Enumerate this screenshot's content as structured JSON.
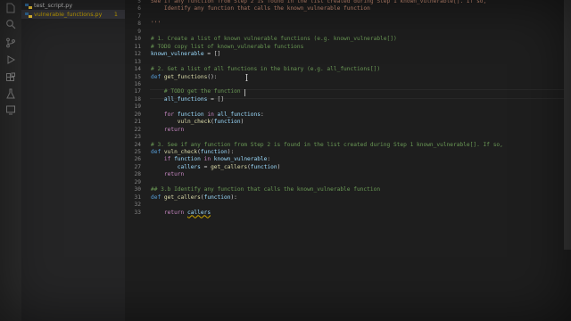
{
  "explorer": {
    "files": [
      {
        "name": "test_script.py",
        "badge": "",
        "active": false
      },
      {
        "name": "vulnerable_functions.py",
        "badge": "1",
        "active": true
      }
    ]
  },
  "activity_icons": [
    "files-icon",
    "search-icon",
    "source-control-icon",
    "run-debug-icon",
    "extensions-icon",
    "testing-icon",
    "remote-explorer-icon"
  ],
  "editor": {
    "lines": [
      {
        "n": "5",
        "segs": [
          {
            "c": "st",
            "t": "See if any function from Step 2 is found in the list created during Step 1 known_vulnerable[]. If so,"
          }
        ]
      },
      {
        "n": "6",
        "segs": [
          {
            "c": "st",
            "t": "    Identify any function that calls the known_vulnerable function"
          }
        ]
      },
      {
        "n": "7",
        "segs": []
      },
      {
        "n": "8",
        "segs": [
          {
            "c": "st",
            "t": "'''"
          }
        ]
      },
      {
        "n": "9",
        "segs": []
      },
      {
        "n": "10",
        "segs": [
          {
            "c": "cm",
            "t": "# 1. Create a list of known vulnerable functions (e.g. known_vulnerable[])"
          }
        ]
      },
      {
        "n": "11",
        "segs": [
          {
            "c": "cm",
            "t": "# TODO copy list of known_vulnerable functions"
          }
        ]
      },
      {
        "n": "12",
        "segs": [
          {
            "c": "vr",
            "t": "known_vulnerable"
          },
          {
            "c": "pl",
            "t": " = []"
          }
        ]
      },
      {
        "n": "13",
        "segs": []
      },
      {
        "n": "14",
        "segs": [
          {
            "c": "cm",
            "t": "# 2. Get a list of all functions in the binary (e.g. all_functions[])"
          }
        ]
      },
      {
        "n": "15",
        "segs": [
          {
            "c": "kd",
            "t": "def "
          },
          {
            "c": "fn",
            "t": "get_functions"
          },
          {
            "c": "pl",
            "t": "():"
          }
        ]
      },
      {
        "n": "16",
        "segs": []
      },
      {
        "n": "17",
        "segs": [
          {
            "c": "cm",
            "t": "    # TODO get the function "
          }
        ]
      },
      {
        "n": "18",
        "segs": [
          {
            "c": "vr",
            "t": "    all_functions"
          },
          {
            "c": "pl",
            "t": " = []"
          }
        ]
      },
      {
        "n": "19",
        "segs": []
      },
      {
        "n": "20",
        "segs": [
          {
            "c": "kw",
            "t": "    for "
          },
          {
            "c": "vr",
            "t": "function"
          },
          {
            "c": "kw",
            "t": " in "
          },
          {
            "c": "vr",
            "t": "all_functions"
          },
          {
            "c": "pl",
            "t": ":"
          }
        ]
      },
      {
        "n": "21",
        "segs": [
          {
            "c": "fn",
            "t": "        vuln_check"
          },
          {
            "c": "pl",
            "t": "("
          },
          {
            "c": "vr",
            "t": "function"
          },
          {
            "c": "pl",
            "t": ")"
          }
        ]
      },
      {
        "n": "22",
        "segs": [
          {
            "c": "kw",
            "t": "    return"
          }
        ]
      },
      {
        "n": "23",
        "segs": []
      },
      {
        "n": "24",
        "segs": [
          {
            "c": "cm",
            "t": "# 3. See if any function from Step 2 is found in the list created during Step 1 known_vulnerable[]. If so,"
          }
        ]
      },
      {
        "n": "25",
        "segs": [
          {
            "c": "kd",
            "t": "def "
          },
          {
            "c": "fn",
            "t": "vuln_check"
          },
          {
            "c": "pl",
            "t": "("
          },
          {
            "c": "vr",
            "t": "function"
          },
          {
            "c": "pl",
            "t": "):"
          }
        ]
      },
      {
        "n": "26",
        "segs": [
          {
            "c": "kw",
            "t": "    if "
          },
          {
            "c": "vr",
            "t": "function"
          },
          {
            "c": "kw",
            "t": " in "
          },
          {
            "c": "vr",
            "t": "known_vulnerable"
          },
          {
            "c": "pl",
            "t": ":"
          }
        ]
      },
      {
        "n": "27",
        "segs": [
          {
            "c": "vr",
            "t": "        callers"
          },
          {
            "c": "pl",
            "t": " = "
          },
          {
            "c": "fn",
            "t": "get_callers"
          },
          {
            "c": "pl",
            "t": "("
          },
          {
            "c": "vr",
            "t": "function"
          },
          {
            "c": "pl",
            "t": ")"
          }
        ]
      },
      {
        "n": "28",
        "segs": [
          {
            "c": "kw",
            "t": "    return"
          }
        ]
      },
      {
        "n": "29",
        "segs": []
      },
      {
        "n": "30",
        "segs": [
          {
            "c": "cm",
            "t": "## 3.b Identify any function that calls the known_vulnerable function"
          }
        ]
      },
      {
        "n": "31",
        "segs": [
          {
            "c": "kd",
            "t": "def "
          },
          {
            "c": "fn",
            "t": "get_callers"
          },
          {
            "c": "pl",
            "t": "("
          },
          {
            "c": "vr",
            "t": "function"
          },
          {
            "c": "pl",
            "t": "):"
          }
        ]
      },
      {
        "n": "32",
        "segs": []
      },
      {
        "n": "33",
        "segs": [
          {
            "c": "kw",
            "t": "    return "
          },
          {
            "c": "vr squig",
            "t": "callers"
          }
        ]
      }
    ]
  }
}
